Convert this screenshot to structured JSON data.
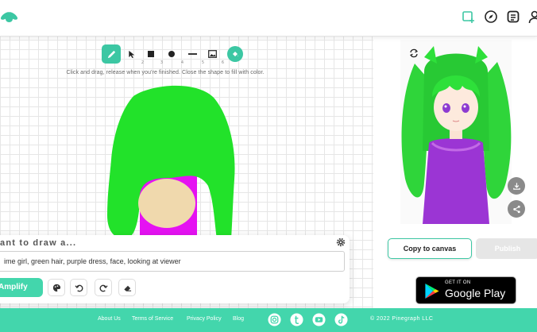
{
  "header": {
    "icons": [
      "logo-leaf-icon",
      "new-canvas-icon",
      "compass-icon",
      "document-icon",
      "user-icon"
    ]
  },
  "toolbar": {
    "tools": [
      "pencil",
      "select",
      "rectangle",
      "circle",
      "line",
      "image",
      "fill"
    ],
    "hint": "Click and drag, release when you're finished. Close the shape to fill with color."
  },
  "prompt": {
    "title": "ant to draw a...",
    "value": "ime girl, green hair, purple dress, face, looking at viewer",
    "amplify_label": "Amplify"
  },
  "result": {
    "copy_label": "Copy to canvas",
    "publish_label": "Publish"
  },
  "store_badge": {
    "small_text": "GET IT ON",
    "big_text": "Google Play"
  },
  "footer": {
    "links": [
      "About Us",
      "Terms of Service",
      "Privacy Policy",
      "Blog"
    ],
    "copyright": "© 2022 Pinegraph LLC"
  },
  "colors": {
    "accent": "#43d6ac",
    "hair_green": "#22e22a",
    "dress_magenta": "#e512f2",
    "skin": "#f0d9ad"
  }
}
